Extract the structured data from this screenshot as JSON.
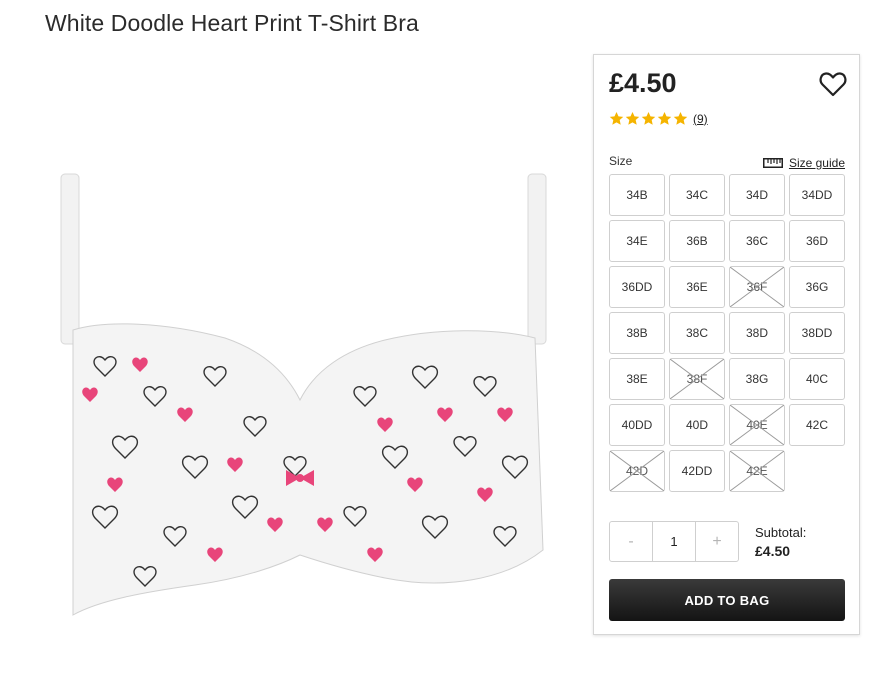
{
  "product": {
    "title": "White Doodle Heart Print T-Shirt Bra",
    "image_icon": "bra-product-photo"
  },
  "panel": {
    "price": "£4.50",
    "wishlist_icon": "heart-outline-icon",
    "rating": {
      "stars": 5,
      "review_count": "(9)",
      "star_color": "#f5b400"
    },
    "size_label": "Size",
    "size_guide_label": "Size guide",
    "size_guide_icon": "ruler-icon",
    "sizes": [
      {
        "label": "34B",
        "available": true
      },
      {
        "label": "34C",
        "available": true
      },
      {
        "label": "34D",
        "available": true
      },
      {
        "label": "34DD",
        "available": true
      },
      {
        "label": "34E",
        "available": true
      },
      {
        "label": "36B",
        "available": true
      },
      {
        "label": "36C",
        "available": true
      },
      {
        "label": "36D",
        "available": true
      },
      {
        "label": "36DD",
        "available": true
      },
      {
        "label": "36E",
        "available": true
      },
      {
        "label": "36F",
        "available": false
      },
      {
        "label": "36G",
        "available": true
      },
      {
        "label": "38B",
        "available": true
      },
      {
        "label": "38C",
        "available": true
      },
      {
        "label": "38D",
        "available": true
      },
      {
        "label": "38DD",
        "available": true
      },
      {
        "label": "38E",
        "available": true
      },
      {
        "label": "38F",
        "available": false
      },
      {
        "label": "38G",
        "available": true
      },
      {
        "label": "40C",
        "available": true
      },
      {
        "label": "40DD",
        "available": true
      },
      {
        "label": "40D",
        "available": true
      },
      {
        "label": "40E",
        "available": false
      },
      {
        "label": "42C",
        "available": true
      },
      {
        "label": "42D",
        "available": false
      },
      {
        "label": "42DD",
        "available": true
      },
      {
        "label": "42E",
        "available": false
      }
    ],
    "quantity": {
      "minus": "-",
      "value": "1",
      "plus": "+"
    },
    "subtotal_label": "Subtotal:",
    "subtotal_value": "£4.50",
    "add_to_bag_label": "ADD TO BAG",
    "colors": {
      "button_dark": "#1f1f1f",
      "pink_accent": "#e8457a"
    }
  }
}
